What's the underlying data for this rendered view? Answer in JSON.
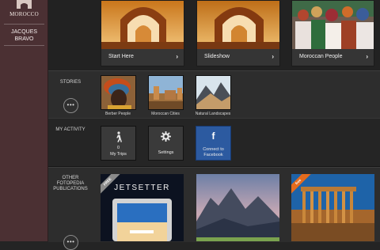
{
  "app": {
    "name": "MOROCCO",
    "user_name": "JACQUES\nBRAVO"
  },
  "featured": [
    {
      "label": "Start Here",
      "art": "arch-icon"
    },
    {
      "label": "Slideshow",
      "art": "arch-icon"
    },
    {
      "label": "Moroccan People",
      "art": "people-icon"
    }
  ],
  "sections": {
    "stories": "STORIES",
    "activity": "MY ACTIVITY",
    "publications": "OTHER\nFOTOPEDIA\nPUBLICATIONS"
  },
  "more_label": "•••",
  "stories": [
    {
      "label": "Berber People"
    },
    {
      "label": "Moroccan Cities"
    },
    {
      "label": "Natural Landscapes"
    }
  ],
  "activity": {
    "trips_count": "0",
    "trips_label": "My Trips",
    "settings_label": "Settings",
    "facebook_label": "Connect to\nFacebook"
  },
  "publications": [
    {
      "title": "JETSETTER",
      "ribbon": "FREE",
      "ribbon_color": "#8a8a8a"
    },
    {
      "title": "",
      "ribbon": "",
      "ribbon_color": ""
    },
    {
      "title": "",
      "ribbon": "free",
      "ribbon_color": "#e46b1d"
    }
  ],
  "colors": {
    "sidebar": "#4b3033",
    "facebook": "#2c5aa0"
  }
}
